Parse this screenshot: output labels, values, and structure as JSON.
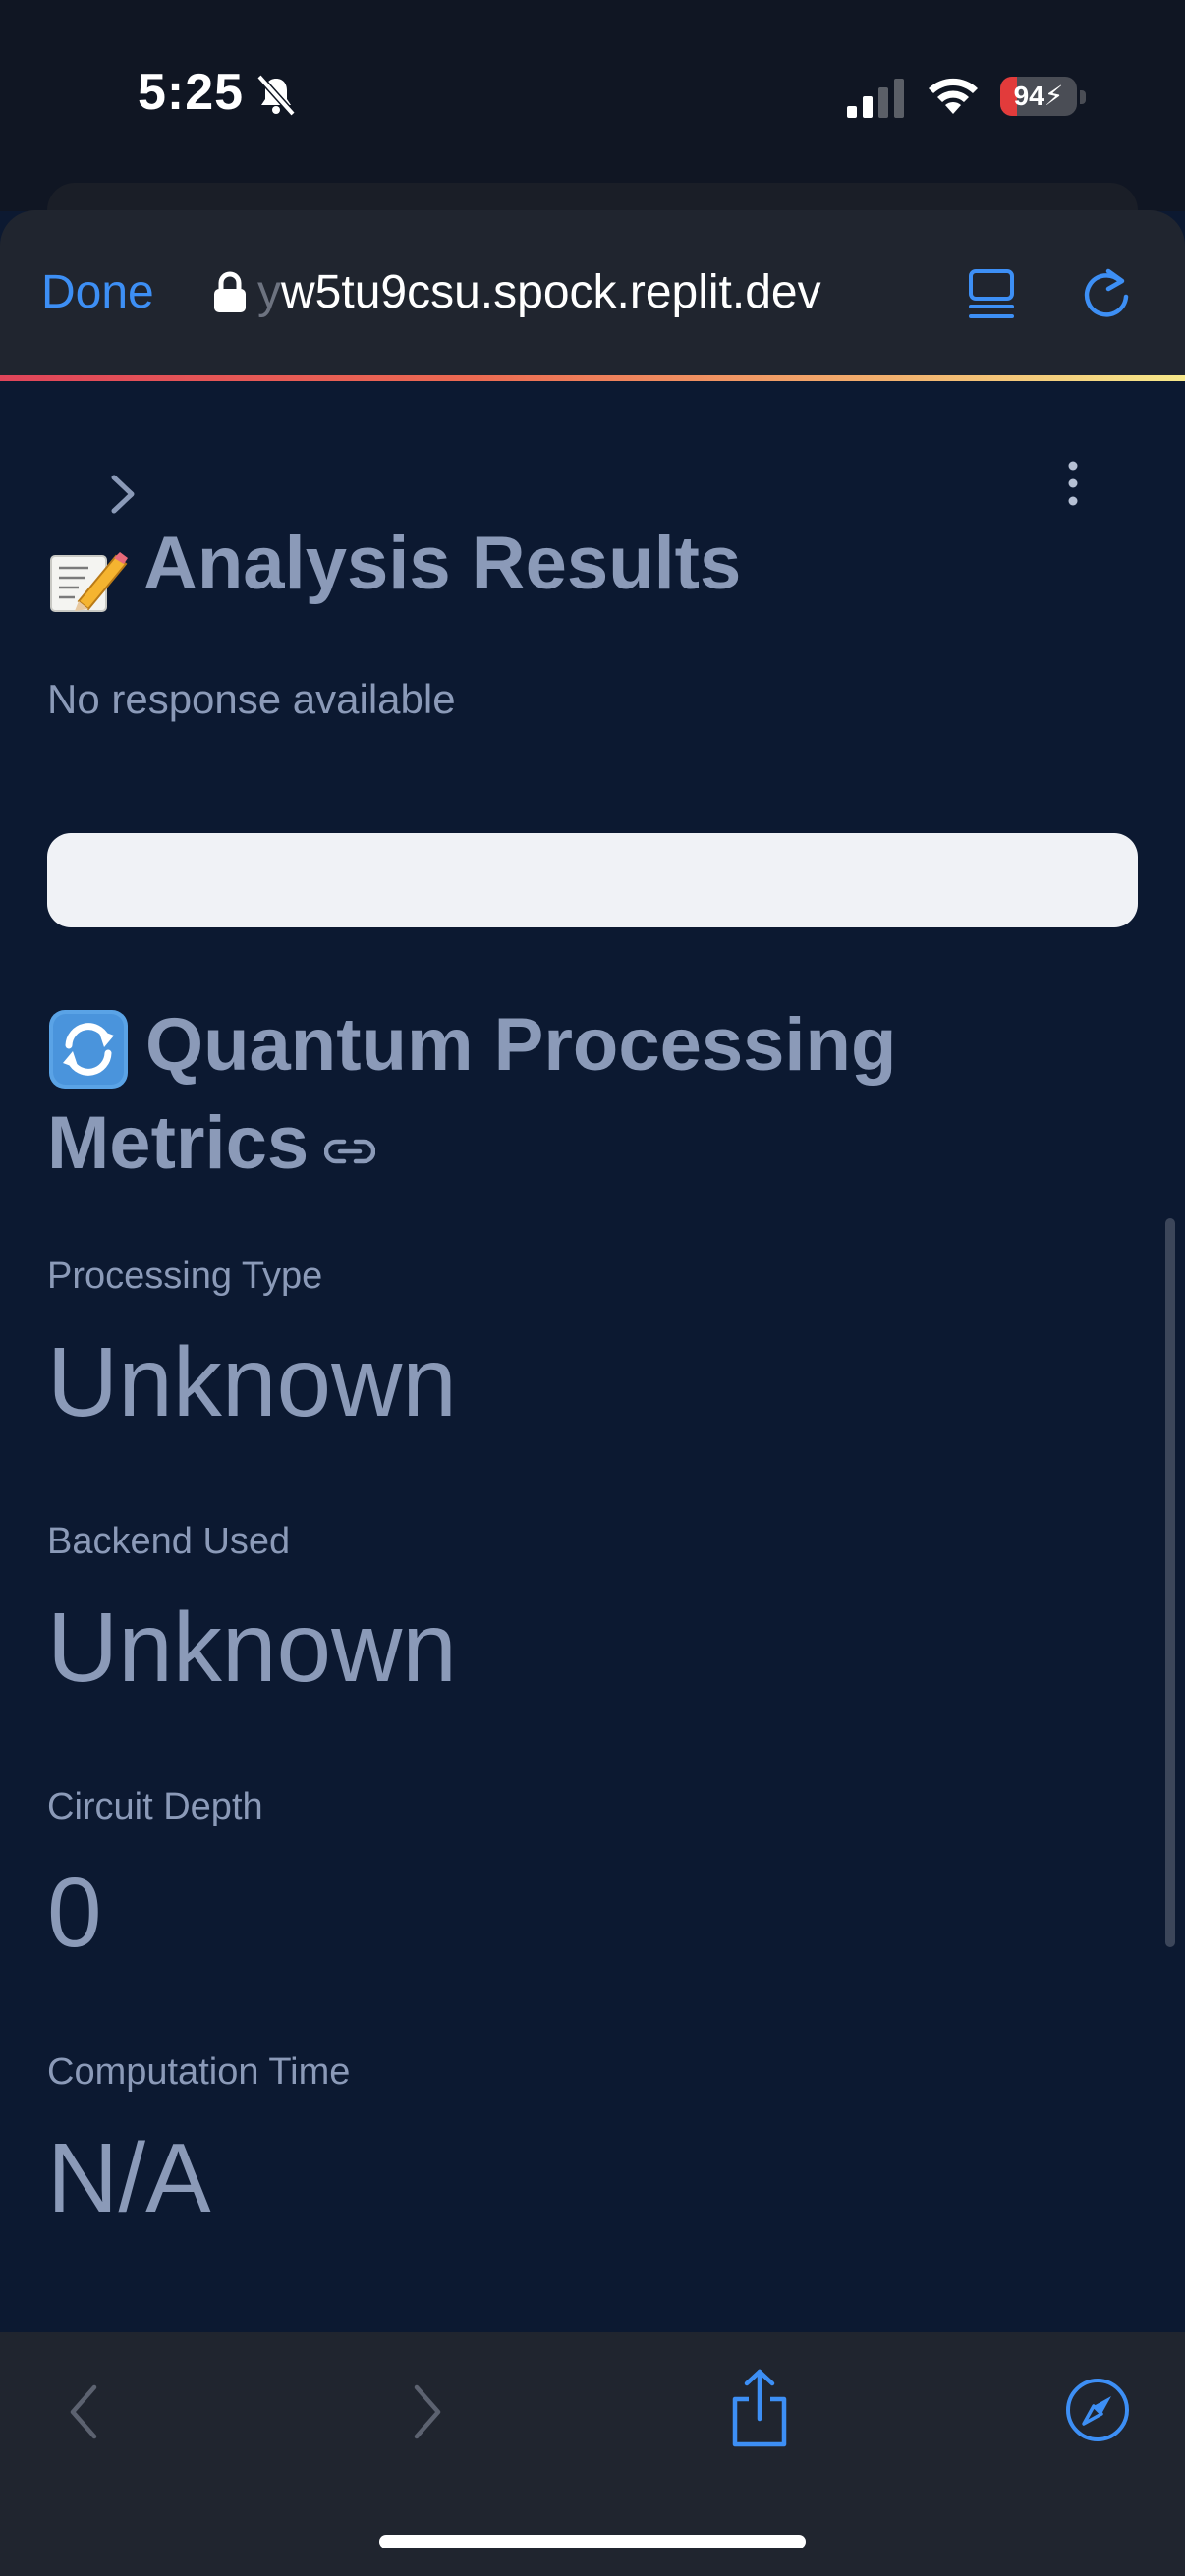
{
  "status_bar": {
    "time": "5:25",
    "battery_level": "94",
    "battery_fraction": 0.22
  },
  "browser": {
    "done_label": "Done",
    "url_faded_prefix": "y",
    "url": "w5tu9csu.spock.replit.dev",
    "icons": {
      "lock": "lock-icon",
      "reader": "reader-icon",
      "reload": "reload-icon",
      "back": "back-icon",
      "forward": "forward-icon",
      "share": "share-icon",
      "compass": "compass-icon"
    }
  },
  "page": {
    "analysis": {
      "emoji_icon": "memo-icon",
      "title": "Analysis Results",
      "response_text": "No response available"
    },
    "quantum": {
      "emoji_icon": "counterclockwise-arrows-icon",
      "title_line1": "Quantum Processing",
      "title_line2": "Metrics",
      "metrics": [
        {
          "label": "Processing Type",
          "value": "Unknown"
        },
        {
          "label": "Backend Used",
          "value": "Unknown"
        },
        {
          "label": "Circuit Depth",
          "value": "0"
        },
        {
          "label": "Computation Time",
          "value": "N/A"
        }
      ]
    }
  },
  "colors": {
    "page_background": "#0c1931",
    "text_muted": "#8b9ab8",
    "browser_chrome": "#20252f",
    "accent_blue": "#3d8ff5",
    "battery_low": "#e23b3b"
  }
}
